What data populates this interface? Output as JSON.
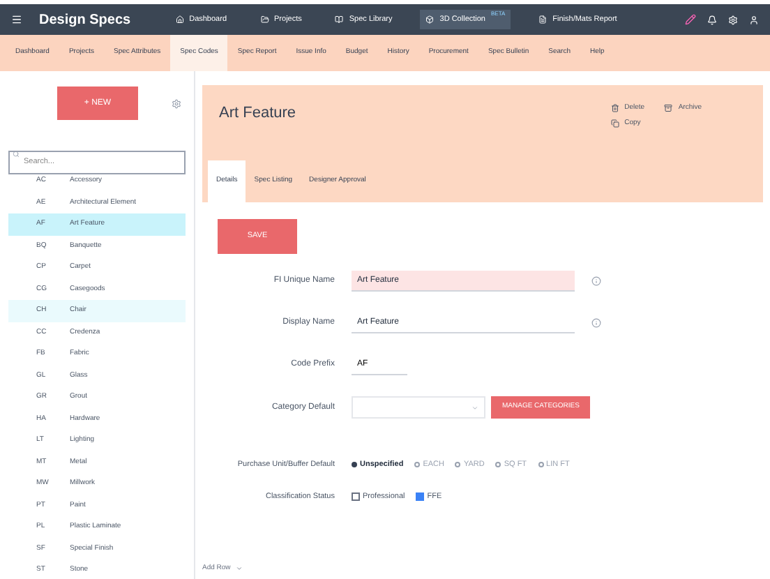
{
  "app": {
    "name": "Design Specs"
  },
  "top_nav": [
    {
      "label": "Dashboard",
      "selected": false
    },
    {
      "label": "Projects",
      "selected": false
    },
    {
      "label": "Spec Library",
      "selected": false
    },
    {
      "label": "3D Collection",
      "badge": "BETA",
      "selected": true
    },
    {
      "label": "Finish/Mats Report",
      "selected": false
    }
  ],
  "sub_tabs": [
    {
      "label": "Dashboard",
      "selected": false
    },
    {
      "label": "Projects",
      "selected": false
    },
    {
      "label": "Spec Attributes",
      "selected": false
    },
    {
      "label": "Spec Codes",
      "selected": true
    },
    {
      "label": "Spec Report",
      "selected": false
    },
    {
      "label": "Issue Info",
      "selected": false
    },
    {
      "label": "Budget",
      "selected": false
    },
    {
      "label": "History",
      "selected": false
    },
    {
      "label": "Procurement",
      "selected": false
    },
    {
      "label": "Spec Bulletin",
      "selected": false
    },
    {
      "label": "Search",
      "selected": false
    },
    {
      "label": "Help",
      "selected": false
    }
  ],
  "sidebar": {
    "new_button": "+ NEW",
    "search": {
      "placeholder": "Search..."
    },
    "items": [
      {
        "code": "AC",
        "name": "Accessory",
        "selected": false
      },
      {
        "code": "AE",
        "name": "Architectural Element",
        "selected": false
      },
      {
        "code": "AF",
        "name": "Art Feature",
        "selected": true
      },
      {
        "code": "BQ",
        "name": "Banquette",
        "selected": false
      },
      {
        "code": "CP",
        "name": "Carpet",
        "selected": false
      },
      {
        "code": "CG",
        "name": "Casegoods",
        "selected": false
      },
      {
        "code": "CH",
        "name": "Chair",
        "selected": false,
        "hover": true
      },
      {
        "code": "CC",
        "name": "Credenza",
        "selected": false
      },
      {
        "code": "FB",
        "name": "Fabric",
        "selected": false
      },
      {
        "code": "GL",
        "name": "Glass",
        "selected": false
      },
      {
        "code": "GR",
        "name": "Grout",
        "selected": false
      },
      {
        "code": "HA",
        "name": "Hardware",
        "selected": false
      },
      {
        "code": "LT",
        "name": "Lighting",
        "selected": false
      },
      {
        "code": "MT",
        "name": "Metal",
        "selected": false
      },
      {
        "code": "MW",
        "name": "Millwork",
        "selected": false
      },
      {
        "code": "PT",
        "name": "Paint",
        "selected": false
      },
      {
        "code": "PL",
        "name": "Plastic Laminate",
        "selected": false
      },
      {
        "code": "SF",
        "name": "Special Finish",
        "selected": false
      },
      {
        "code": "ST",
        "name": "Stone",
        "selected": false
      }
    ]
  },
  "header": {
    "title": "Art Feature",
    "actions": [
      "Delete",
      "Archive",
      "Copy"
    ]
  },
  "detail_tabs": [
    {
      "label": "Details",
      "selected": true
    },
    {
      "label": "Spec Listing",
      "selected": false
    },
    {
      "label": "Designer Approval",
      "selected": false
    }
  ],
  "save_button": "SAVE",
  "form": {
    "unique_name": {
      "label": "FI Unique Name",
      "value": "Art Feature"
    },
    "display_name": {
      "label": "Display Name",
      "value": "Art Feature"
    },
    "code_prefix": {
      "label": "Code Prefix",
      "value": "AF"
    },
    "category": {
      "label": "Category Default",
      "button": "MANAGE CATEGORIES"
    },
    "purchase_unit": {
      "label": "Purchase Unit/Buffer Default",
      "options": [
        {
          "label": "Unspecified",
          "selected": true
        },
        {
          "label": "EACH",
          "selected": false
        },
        {
          "label": "YARD",
          "selected": false
        },
        {
          "label": "SQ FT",
          "selected": false
        },
        {
          "label": "LIN FT",
          "selected": false
        }
      ]
    },
    "classification": {
      "label": "Classification Status",
      "options": [
        {
          "label": "Professional",
          "checked": false
        },
        {
          "label": "FFE",
          "checked": true
        }
      ]
    }
  },
  "footer": {
    "label": "Add Row"
  }
}
